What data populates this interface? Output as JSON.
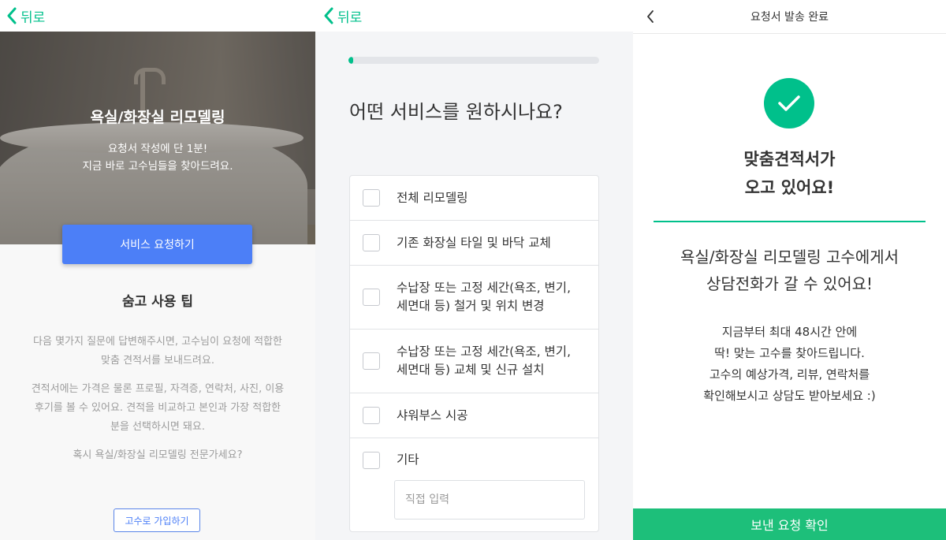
{
  "panel1": {
    "back_label": "뒤로",
    "hero_title": "욕실/화장실 리모델링",
    "hero_sub_line1": "요청서 작성에 단 1분!",
    "hero_sub_line2": "지금 바로 고수님들을 찾아드려요.",
    "request_button": "서비스 요청하기",
    "tips_title": "숨고 사용 팁",
    "tip1_line1": "다음 몇가지 질문에 답변해주시면, 고수님이 요청에 적합한",
    "tip1_line2": "맞춤 견적서를 보내드려요.",
    "tip2_line1": "견적서에는 가격은 물론 프로필, 자격증, 연락처, 사진, 이용",
    "tip2_line2": "후기를 볼 수 있어요. 견적을 비교하고 본인과 가장 적합한",
    "tip2_line3": "분을 선택하시면 돼요.",
    "tip3": "혹시 욕실/화장실 리모델링 전문가세요?",
    "join_button": "고수로 가입하기"
  },
  "panel2": {
    "back_label": "뒤로",
    "progress_percent": 2,
    "question": "어떤 서비스를 원하시나요?",
    "options": [
      {
        "line1": "전체 리모델링"
      },
      {
        "line1": "기존 화장실 타일 및 바닥 교체"
      },
      {
        "line1": "수납장 또는 고정 세간(욕조, 변기,",
        "line2": "세면대 등) 철거 및 위치 변경"
      },
      {
        "line1": "수납장 또는 고정 세간(욕조, 변기,",
        "line2": "세면대 등) 교체 및 신규 설치"
      },
      {
        "line1": "샤워부스 시공"
      },
      {
        "line1": "기타"
      }
    ],
    "direct_input_placeholder": "직접 입력"
  },
  "panel3": {
    "title": "요청서 발송 완료",
    "done_line1": "맞춤견적서가",
    "done_line2": "오고 있어요!",
    "msg_line1": "욕실/화장실 리모델링 고수에게서",
    "msg_line2": "상담전화가 갈 수 있어요!",
    "info_line1": "지금부터 최대 48시간 안에",
    "info_line2": "딱! 맞는 고수를 찾아드립니다.",
    "info_line3": "고수의 예상가격, 리뷰, 연락처를",
    "info_line4": "확인해보시고 상담도 받아보세요 :)",
    "confirm_button": "보낸 요청 확인"
  },
  "colors": {
    "accent_green": "#00c08b",
    "button_blue": "#4c7ff7",
    "confirm_green": "#1dbf7a"
  }
}
